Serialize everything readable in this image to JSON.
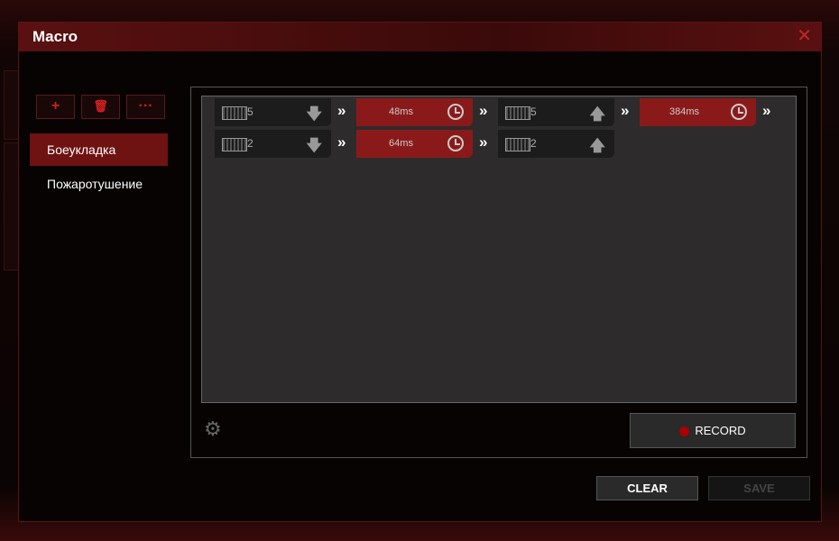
{
  "dialog": {
    "title": "Macro",
    "close_icon": "close-icon"
  },
  "toolbar": {
    "add": "+",
    "delete_icon": "trash-icon",
    "more": "···"
  },
  "macros": [
    {
      "label": "Боеукладка",
      "selected": true
    },
    {
      "label": "Пожаротушение",
      "selected": false
    }
  ],
  "rows": [
    [
      {
        "type": "key",
        "value": "5",
        "dir": "down"
      },
      {
        "type": "delay",
        "value": "48ms"
      },
      {
        "type": "key",
        "value": "5",
        "dir": "up"
      },
      {
        "type": "delay",
        "value": "384ms"
      }
    ],
    [
      {
        "type": "key",
        "value": "2",
        "dir": "down"
      },
      {
        "type": "delay",
        "value": "64ms"
      },
      {
        "type": "key",
        "value": "2",
        "dir": "up"
      }
    ]
  ],
  "buttons": {
    "record": "RECORD",
    "clear": "CLEAR",
    "save": "SAVE"
  },
  "colors": {
    "accent": "#8a1a1a",
    "selected": "#6e1212",
    "record_dot": "#aa0000"
  }
}
